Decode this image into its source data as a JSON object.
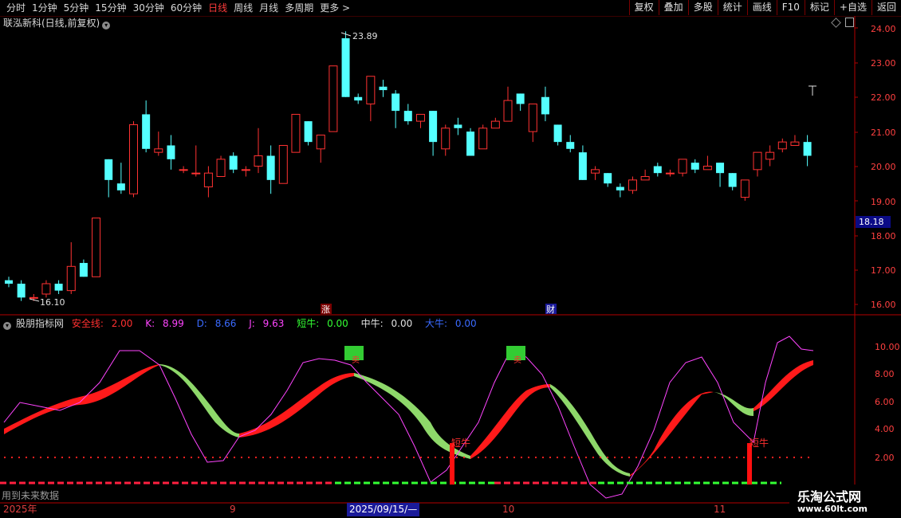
{
  "toolbar": {
    "periods": [
      "分时",
      "1分钟",
      "5分钟",
      "15分钟",
      "30分钟",
      "60分钟",
      "日线",
      "周线",
      "月线",
      "多周期",
      "更多 >"
    ],
    "active_period": "日线",
    "actions": [
      "复权",
      "叠加",
      "多股",
      "统计",
      "画线",
      "F10",
      "标记",
      "+自选",
      "返回"
    ]
  },
  "main_chart": {
    "title": "联泓新科(日线,前复权)",
    "price_axis_labels": [
      "24.00",
      "23.00",
      "22.00",
      "21.00",
      "20.00",
      "19.00",
      "18.00",
      "17.00",
      "16.00"
    ],
    "current_price_badge": "18.18",
    "high_annotation": "23.89",
    "low_annotation": "16.10",
    "markers": [
      "涨",
      "财"
    ],
    "colors": {
      "up": "#ff3232",
      "down": "#54ffff",
      "axis": "#b40000",
      "text": "#ff4040"
    }
  },
  "indicator": {
    "name": "股朋指标网",
    "readouts": [
      {
        "label": "安全线:",
        "value": "2.00",
        "color": "#ff3030"
      },
      {
        "label": "K:",
        "value": "8.99",
        "color": "#ff44ff"
      },
      {
        "label": "D:",
        "value": "8.66",
        "color": "#3a6aff"
      },
      {
        "label": "J:",
        "value": "9.63",
        "color": "#ff44ff"
      },
      {
        "label": "短牛:",
        "value": "0.00",
        "color": "#33ff33"
      },
      {
        "label": "中牛:",
        "value": "0.00",
        "color": "#e0e0e0"
      },
      {
        "label": "大牛:",
        "value": "0.00",
        "color": "#3a6aff"
      }
    ],
    "axis_labels": [
      "10.00",
      "8.00",
      "6.00",
      "4.00",
      "2.00"
    ],
    "signal_text_buy": "短牛",
    "signal_text_sell": "卖"
  },
  "footer": {
    "future_data": "用到未来数据",
    "date_labels": [
      "2025年",
      "9",
      "10",
      "11"
    ],
    "selected_date": "2025/09/15/—"
  },
  "watermark": {
    "title": "乐淘公式网",
    "url": "www.60lt.com"
  },
  "chart_data": {
    "type": "candlestick",
    "title": "联泓新科(日线,前复权)",
    "ylim": [
      15.8,
      24.2
    ],
    "up_color": "#ff3232",
    "down_color": "#54ffff",
    "candles": [
      {
        "o": 16.7,
        "c": 16.6,
        "h": 16.8,
        "l": 16.5
      },
      {
        "o": 16.6,
        "c": 16.2,
        "h": 16.7,
        "l": 16.1
      },
      {
        "o": 16.2,
        "c": 16.2,
        "h": 16.3,
        "l": 16.1
      },
      {
        "o": 16.3,
        "c": 16.6,
        "h": 16.7,
        "l": 16.2
      },
      {
        "o": 16.6,
        "c": 16.4,
        "h": 16.7,
        "l": 16.3
      },
      {
        "o": 16.4,
        "c": 17.1,
        "h": 17.8,
        "l": 16.3
      },
      {
        "o": 17.2,
        "c": 16.8,
        "h": 17.3,
        "l": 16.8
      },
      {
        "o": 16.8,
        "c": 18.5,
        "h": 18.5,
        "l": 16.8
      },
      {
        "o": 20.2,
        "c": 19.6,
        "h": 20.2,
        "l": 19.1
      },
      {
        "o": 19.5,
        "c": 19.3,
        "h": 20.1,
        "l": 19.2
      },
      {
        "o": 19.2,
        "c": 21.2,
        "h": 21.3,
        "l": 19.1
      },
      {
        "o": 21.5,
        "c": 20.5,
        "h": 21.9,
        "l": 20.4
      },
      {
        "o": 20.4,
        "c": 20.5,
        "h": 21.0,
        "l": 20.3
      },
      {
        "o": 20.6,
        "c": 20.2,
        "h": 20.9,
        "l": 19.9
      },
      {
        "o": 19.9,
        "c": 19.9,
        "h": 20.0,
        "l": 19.8
      },
      {
        "o": 19.8,
        "c": 19.8,
        "h": 20.6,
        "l": 19.7
      },
      {
        "o": 19.4,
        "c": 19.8,
        "h": 20.0,
        "l": 19.1
      },
      {
        "o": 19.7,
        "c": 20.2,
        "h": 20.3,
        "l": 19.7
      },
      {
        "o": 20.3,
        "c": 19.9,
        "h": 20.4,
        "l": 19.8
      },
      {
        "o": 19.9,
        "c": 19.9,
        "h": 20.0,
        "l": 19.7
      },
      {
        "o": 20.0,
        "c": 20.3,
        "h": 21.1,
        "l": 19.8
      },
      {
        "o": 20.3,
        "c": 19.6,
        "h": 20.6,
        "l": 19.2
      },
      {
        "o": 19.5,
        "c": 20.6,
        "h": 20.6,
        "l": 19.5
      },
      {
        "o": 20.4,
        "c": 21.5,
        "h": 21.5,
        "l": 20.4
      },
      {
        "o": 21.3,
        "c": 20.7,
        "h": 21.3,
        "l": 20.6
      },
      {
        "o": 20.5,
        "c": 20.9,
        "h": 20.9,
        "l": 20.1
      },
      {
        "o": 21.0,
        "c": 22.9,
        "h": 22.9,
        "l": 21.0
      },
      {
        "o": 23.7,
        "c": 22.0,
        "h": 23.9,
        "l": 22.0
      },
      {
        "o": 22.0,
        "c": 21.9,
        "h": 22.1,
        "l": 21.8
      },
      {
        "o": 21.8,
        "c": 22.6,
        "h": 22.6,
        "l": 21.3
      },
      {
        "o": 22.3,
        "c": 22.2,
        "h": 22.5,
        "l": 22.0
      },
      {
        "o": 22.1,
        "c": 21.6,
        "h": 22.2,
        "l": 21.1
      },
      {
        "o": 21.6,
        "c": 21.3,
        "h": 21.8,
        "l": 21.2
      },
      {
        "o": 21.3,
        "c": 21.5,
        "h": 21.5,
        "l": 21.1
      },
      {
        "o": 21.6,
        "c": 20.7,
        "h": 21.6,
        "l": 20.3
      },
      {
        "o": 20.5,
        "c": 21.1,
        "h": 21.2,
        "l": 20.3
      },
      {
        "o": 21.2,
        "c": 21.1,
        "h": 21.4,
        "l": 20.9
      },
      {
        "o": 21.0,
        "c": 20.3,
        "h": 21.1,
        "l": 20.3
      },
      {
        "o": 20.5,
        "c": 21.1,
        "h": 21.2,
        "l": 20.5
      },
      {
        "o": 21.1,
        "c": 21.3,
        "h": 21.4,
        "l": 21.1
      },
      {
        "o": 21.3,
        "c": 21.9,
        "h": 22.3,
        "l": 21.3
      },
      {
        "o": 22.1,
        "c": 21.8,
        "h": 22.1,
        "l": 21.6
      },
      {
        "o": 21.0,
        "c": 21.8,
        "h": 21.8,
        "l": 20.7
      },
      {
        "o": 22.0,
        "c": 21.5,
        "h": 22.3,
        "l": 21.3
      },
      {
        "o": 21.2,
        "c": 20.7,
        "h": 21.2,
        "l": 20.6
      },
      {
        "o": 20.7,
        "c": 20.5,
        "h": 20.9,
        "l": 20.4
      },
      {
        "o": 20.4,
        "c": 19.6,
        "h": 20.6,
        "l": 19.6
      },
      {
        "o": 19.8,
        "c": 19.9,
        "h": 20.0,
        "l": 19.6
      },
      {
        "o": 19.8,
        "c": 19.5,
        "h": 19.8,
        "l": 19.4
      },
      {
        "o": 19.4,
        "c": 19.3,
        "h": 19.5,
        "l": 19.1
      },
      {
        "o": 19.3,
        "c": 19.6,
        "h": 19.7,
        "l": 19.2
      },
      {
        "o": 19.6,
        "c": 19.7,
        "h": 19.9,
        "l": 19.6
      },
      {
        "o": 20.0,
        "c": 19.8,
        "h": 20.1,
        "l": 19.7
      },
      {
        "o": 19.8,
        "c": 19.8,
        "h": 19.9,
        "l": 19.7
      },
      {
        "o": 19.8,
        "c": 20.2,
        "h": 20.2,
        "l": 19.7
      },
      {
        "o": 20.1,
        "c": 19.9,
        "h": 20.2,
        "l": 19.8
      },
      {
        "o": 19.9,
        "c": 20.0,
        "h": 20.3,
        "l": 19.9
      },
      {
        "o": 20.1,
        "c": 19.8,
        "h": 20.1,
        "l": 19.4
      },
      {
        "o": 19.8,
        "c": 19.4,
        "h": 19.8,
        "l": 19.3
      },
      {
        "o": 19.1,
        "c": 19.6,
        "h": 19.6,
        "l": 19.0
      },
      {
        "o": 19.9,
        "c": 20.4,
        "h": 20.4,
        "l": 19.7
      },
      {
        "o": 20.2,
        "c": 20.4,
        "h": 20.6,
        "l": 20.0
      },
      {
        "o": 20.5,
        "c": 20.7,
        "h": 20.8,
        "l": 20.4
      },
      {
        "o": 20.6,
        "c": 20.7,
        "h": 20.9,
        "l": 20.6
      },
      {
        "o": 20.7,
        "c": 20.3,
        "h": 20.9,
        "l": 20.0
      }
    ]
  }
}
